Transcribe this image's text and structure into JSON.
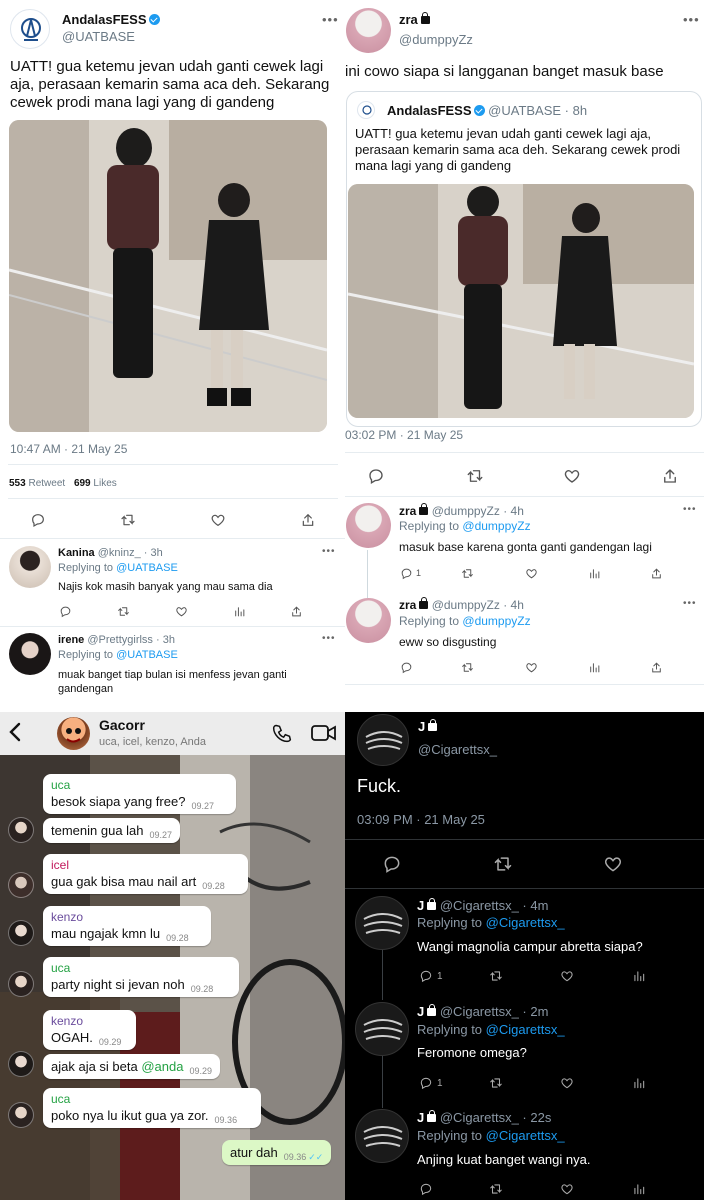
{
  "p1": {
    "author": "AndalasFESS",
    "handle": "@UATBASE",
    "text": "UATT! gua ketemu jevan udah ganti cewek lagi aja, perasaan kemarin sama aca deh. Sekarang cewek prodi mana lagi yang di gandeng",
    "timestamp": "10:47 AM · 21 May 25",
    "retweet_count": "553",
    "retweet_label": "Retweet",
    "like_count": "699",
    "like_label": "Likes",
    "replies": [
      {
        "name": "Kanina",
        "handle": "@kninz_ · 3h",
        "replying": "Replying to",
        "to": "@UATBASE",
        "text": "Najis kok masih banyak yang mau sama dia"
      },
      {
        "name": "irene",
        "handle": "@Prettygirlss · 3h",
        "replying": "Replying to",
        "to": "@UATBASE",
        "text": "muak banget tiap bulan isi menfess jevan ganti gandengan"
      }
    ]
  },
  "p2": {
    "author": "zra",
    "handle": "@dumppyZz",
    "text": "ini cowo siapa si langganan banget masuk base",
    "quote": {
      "author": "AndalasFESS",
      "handle": "@UATBASE · 8h",
      "text": "UATT! gua ketemu jevan udah ganti cewek lagi aja, perasaan kemarin sama aca deh. Sekarang cewek prodi mana lagi yang di gandeng"
    },
    "timestamp": "03:02 PM · 21 May 25",
    "replies": [
      {
        "name": "zra",
        "handle": "@dumppyZz · 4h",
        "replying": "Replying to",
        "to": "@dumppyZz",
        "text": "masuk base karena gonta ganti gandengan lagi",
        "reply_count": "1"
      },
      {
        "name": "zra",
        "handle": "@dumppyZz · 4h",
        "replying": "Replying to",
        "to": "@dumppyZz",
        "text": "eww so disgusting",
        "reply_count": ""
      }
    ]
  },
  "p3": {
    "group_name": "Gacorr",
    "members": "uca, icel, kenzo, Anda",
    "messages": [
      {
        "sender": "uca",
        "text": "besok siapa yang free?",
        "time": "09.27"
      },
      {
        "sender": "",
        "text": "temenin gua lah",
        "time": "09.27"
      },
      {
        "sender": "icel",
        "text": "gua gak bisa mau nail art",
        "time": "09.28"
      },
      {
        "sender": "kenzo",
        "text": "mau ngajak kmn lu",
        "time": "09.28"
      },
      {
        "sender": "uca",
        "text": "party night si jevan noh",
        "time": "09.28"
      },
      {
        "sender": "kenzo",
        "text": "OGAH.",
        "time": "09.29"
      },
      {
        "sender": "",
        "text": "ajak aja si beta",
        "mention": "@anda",
        "time": "09.29"
      },
      {
        "sender": "uca",
        "text": "poko nya lu ikut gua ya zor.",
        "time": "09.36"
      },
      {
        "sender": "",
        "text": "atur dah",
        "time": "09.36"
      }
    ],
    "colors": {
      "uca": "#25a244",
      "icel": "#c2185b",
      "kenzo": "#6a4c9c",
      "outgoing": "#dcf8c6"
    }
  },
  "p4": {
    "author": "J",
    "handle": "@Cigarettsx_",
    "text": "Fuck.",
    "timestamp": "03:09 PM · 21 May 25",
    "replies": [
      {
        "name": "J",
        "handle": "@Cigarettsx_ · 4m",
        "replying": "Replying to",
        "to": "@Cigarettsx_",
        "text": "Wangi magnolia campur abretta siapa?",
        "reply_count": "1"
      },
      {
        "name": "J",
        "handle": "@Cigarettsx_ · 2m",
        "replying": "Replying to",
        "to": "@Cigarettsx_",
        "text": "Feromone omega?",
        "reply_count": "1"
      },
      {
        "name": "J",
        "handle": "@Cigarettsx_ · 22s",
        "replying": "Replying to",
        "to": "@Cigarettsx_",
        "text": "Anjing kuat banget wangi nya.",
        "reply_count": ""
      }
    ]
  }
}
